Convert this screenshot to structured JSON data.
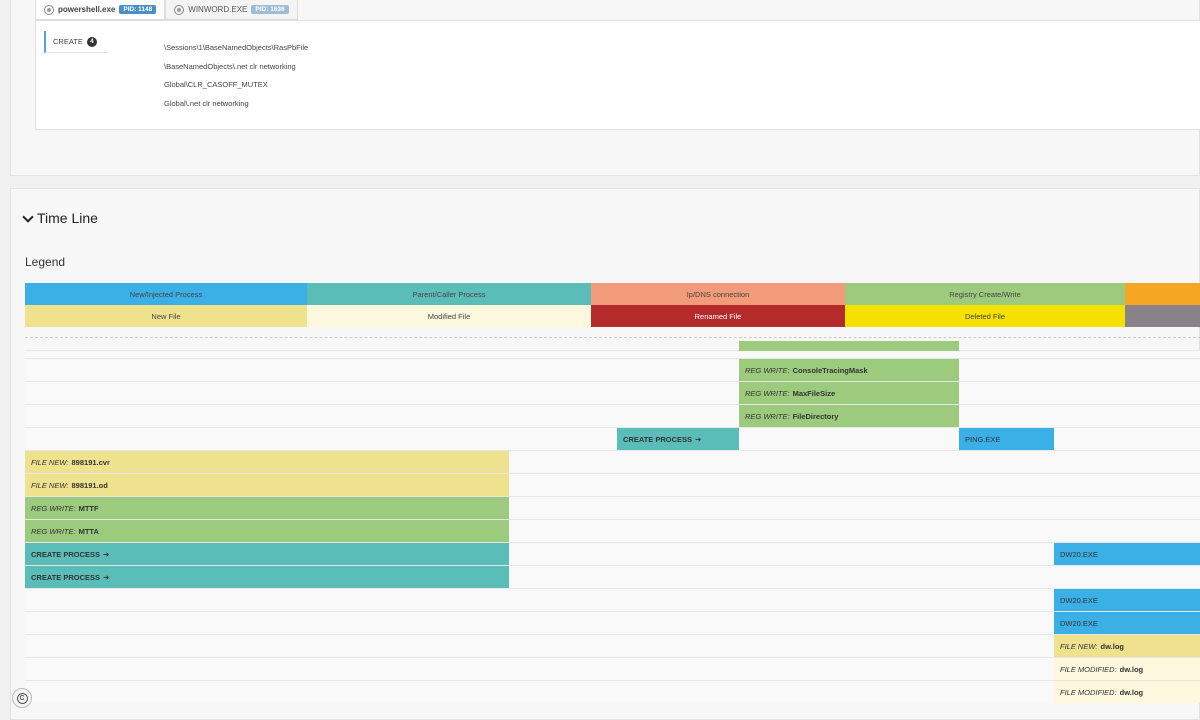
{
  "process_tabs": [
    {
      "name": "powershell.exe",
      "pid": "PID: 1148"
    },
    {
      "name": "WINWORD.EXE",
      "pid": "PID: 1636"
    }
  ],
  "mutex": {
    "tab_label": "CREATE",
    "count": "4",
    "items": [
      "\\Sessions\\1\\BaseNamedObjects\\RasPbFile",
      "\\BaseNamedObjects\\.net clr networking",
      "Global\\CLR_CASOFF_MUTEX",
      "Global\\.net clr networking"
    ]
  },
  "timeline": {
    "title": "Time Line",
    "legend_title": "Legend",
    "legend": [
      {
        "label": "New/Injected Process",
        "color": "#3ab0e6"
      },
      {
        "label": "Parent/Caller Process",
        "color": "#5bbdb8"
      },
      {
        "label": "Ip/DNS connection",
        "color": "#f19b7a"
      },
      {
        "label": "Registry Create/Write",
        "color": "#9ccb7e"
      },
      {
        "label": "",
        "color": "#f5a623"
      },
      {
        "label": "New File",
        "color": "#efe28e"
      },
      {
        "label": "Modified File",
        "color": "#fdf8dd"
      },
      {
        "label": "Renamed File",
        "color": "#b52a2a"
      },
      {
        "label": "Deleted File",
        "color": "#f5e000"
      },
      {
        "label": "",
        "color": "#8a8289"
      }
    ],
    "events": [
      {
        "prefix": "REG WRITE:",
        "value": "ConsoleTracingMask",
        "arrow": "",
        "color": "#9ccb7e"
      },
      {
        "prefix": "REG WRITE:",
        "value": "MaxFileSize",
        "arrow": "",
        "color": "#9ccb7e"
      },
      {
        "prefix": "REG WRITE:",
        "value": "FileDirectory",
        "arrow": "",
        "color": "#9ccb7e"
      },
      {
        "prefix": "",
        "value": "CREATE PROCESS",
        "arrow": "➔",
        "color": "#5bbdb8"
      },
      {
        "prefix": "",
        "value": "PING.EXE",
        "arrow": "",
        "color": "#3ab0e6"
      },
      {
        "prefix": "FILE NEW:",
        "value": "898191.cvr",
        "arrow": "",
        "color": "#efe28e"
      },
      {
        "prefix": "FILE NEW:",
        "value": "898191.od",
        "arrow": "",
        "color": "#efe28e"
      },
      {
        "prefix": "REG WRITE:",
        "value": "MTTF",
        "arrow": "",
        "color": "#9ccb7e"
      },
      {
        "prefix": "REG WRITE:",
        "value": "MTTA",
        "arrow": "",
        "color": "#9ccb7e"
      },
      {
        "prefix": "",
        "value": "CREATE PROCESS",
        "arrow": "➔",
        "color": "#5bbdb8"
      },
      {
        "prefix": "",
        "value": "DW20.EXE",
        "arrow": "",
        "color": "#3ab0e6"
      },
      {
        "prefix": "",
        "value": "CREATE PROCESS",
        "arrow": "➔",
        "color": "#5bbdb8"
      },
      {
        "prefix": "",
        "value": "DW20.EXE",
        "arrow": "",
        "color": "#3ab0e6"
      },
      {
        "prefix": "",
        "value": "DW20.EXE",
        "arrow": "",
        "color": "#3ab0e6"
      },
      {
        "prefix": "FILE NEW:",
        "value": "dw.log",
        "arrow": "",
        "color": "#efe28e"
      },
      {
        "prefix": "FILE MODIFIED:",
        "value": "dw.log",
        "arrow": "",
        "color": "#fdf8dd"
      },
      {
        "prefix": "FILE MODIFIED:",
        "value": "dw.log",
        "arrow": "",
        "color": "#fdf8dd"
      }
    ]
  },
  "icons": {
    "copyright": "copyright-icon",
    "process": "process-icon",
    "collapse": "chevron-down-icon"
  }
}
